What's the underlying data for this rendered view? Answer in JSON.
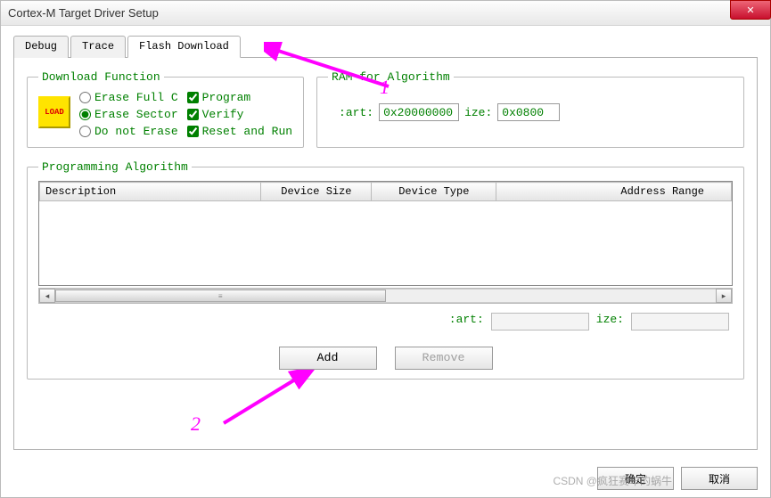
{
  "window": {
    "title": "Cortex-M Target Driver Setup"
  },
  "tabs": {
    "debug": "Debug",
    "trace": "Trace",
    "flash": "Flash Download"
  },
  "download": {
    "legend": "Download Function",
    "load_icon_text": "LOAD",
    "radio_full": "Erase Full C",
    "radio_sector": "Erase Sector",
    "radio_none": "Do not Erase",
    "chk_program": "Program",
    "chk_verify": "Verify",
    "chk_reset": "Reset and Run"
  },
  "ram": {
    "legend": "RAM for Algorithm",
    "start_label": ":art:",
    "start_value": "0x20000000",
    "size_label": "ize:",
    "size_value": "0x0800"
  },
  "prog": {
    "legend": "Programming Algorithm",
    "col_desc": "Description",
    "col_size": "Device Size",
    "col_type": "Device Type",
    "col_range": "Address Range",
    "start_label": ":art:",
    "size_label": "ize:",
    "start_value": "",
    "size_value": ""
  },
  "buttons": {
    "add": "Add",
    "remove": "Remove",
    "ok": "确定",
    "cancel": "取消"
  },
  "annotations": {
    "one": "1",
    "two": "2"
  },
  "watermark": "CSDN @疯狂赛车的蜗牛"
}
